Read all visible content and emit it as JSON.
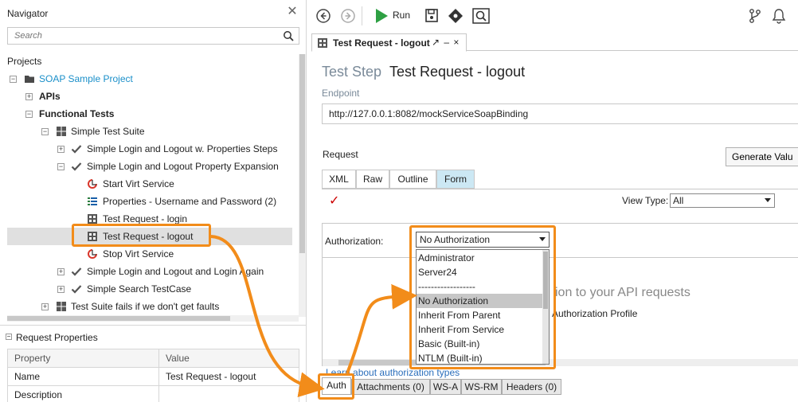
{
  "navigator": {
    "title": "Navigator",
    "search_placeholder": "Search",
    "projects_label": "Projects",
    "tree": [
      {
        "label": "SOAP Sample Project",
        "icon": "folder-icon"
      },
      {
        "label": "APIs",
        "icon": ""
      },
      {
        "label": "Functional Tests",
        "icon": ""
      },
      {
        "label": "Simple Test Suite",
        "icon": "grid-icon"
      },
      {
        "label": "Simple Login and Logout w. Properties Steps",
        "icon": "check-icon"
      },
      {
        "label": "Simple Login and Logout Property Expansion",
        "icon": "check-icon"
      },
      {
        "label": "Start Virt Service",
        "icon": "virt-service-icon"
      },
      {
        "label": "Properties - Username and Password (2)",
        "icon": "properties-icon"
      },
      {
        "label": "Test Request - login",
        "icon": "soap-request-icon"
      },
      {
        "label": "Test Request - logout",
        "icon": "soap-request-icon"
      },
      {
        "label": "Stop Virt Service",
        "icon": "virt-service-icon"
      },
      {
        "label": "Simple Login and Logout and Login Again",
        "icon": "check-icon"
      },
      {
        "label": "Simple Search TestCase",
        "icon": "check-icon"
      },
      {
        "label": "Test Suite fails if we don't get faults",
        "icon": "grid-icon"
      }
    ],
    "project_color": "#1a8fc9"
  },
  "request_properties": {
    "title": "Request Properties",
    "columns": [
      "Property",
      "Value"
    ],
    "rows": [
      {
        "property": "Name",
        "value": "Test Request - logout"
      },
      {
        "property": "Description",
        "value": ""
      }
    ]
  },
  "toolbar": {
    "run_label": "Run",
    "run_color": "#2ea043"
  },
  "editor": {
    "tab_label": "Test Request - logout",
    "tab_controls": "↗ – ×",
    "step_type": "Test Step",
    "step_name": "Test Request - logout",
    "endpoint_label": "Endpoint",
    "endpoint_value": "http://127.0.0.1:8082/mockServiceSoapBinding",
    "request_label": "Request",
    "generate_button": "Generate Valu",
    "request_tabs": [
      "XML",
      "Raw",
      "Outline",
      "Form"
    ],
    "active_request_tab": "Form",
    "view_type_label": "View Type:",
    "view_type_value": "All",
    "authorization_label": "Authorization:",
    "authorization_value": "No Authorization",
    "auth_hint": "ion to your API requests",
    "auth_profile": "Authorization Profile",
    "learn_link": "Learn about authorization types",
    "bottom_tabs": [
      "Auth",
      "Attachments (0)",
      "WS-A",
      "WS-RM",
      "Headers (0)"
    ],
    "active_bottom_tab": "Auth"
  },
  "auth_dropdown": {
    "options": [
      "Administrator",
      "Server24",
      "------------------",
      "No Authorization",
      "Inherit From Parent",
      "Inherit From Service",
      "Basic (Built-in)",
      "NTLM (Built-in)"
    ],
    "highlighted": "No Authorization"
  },
  "annotation_color": "#f28c1a"
}
